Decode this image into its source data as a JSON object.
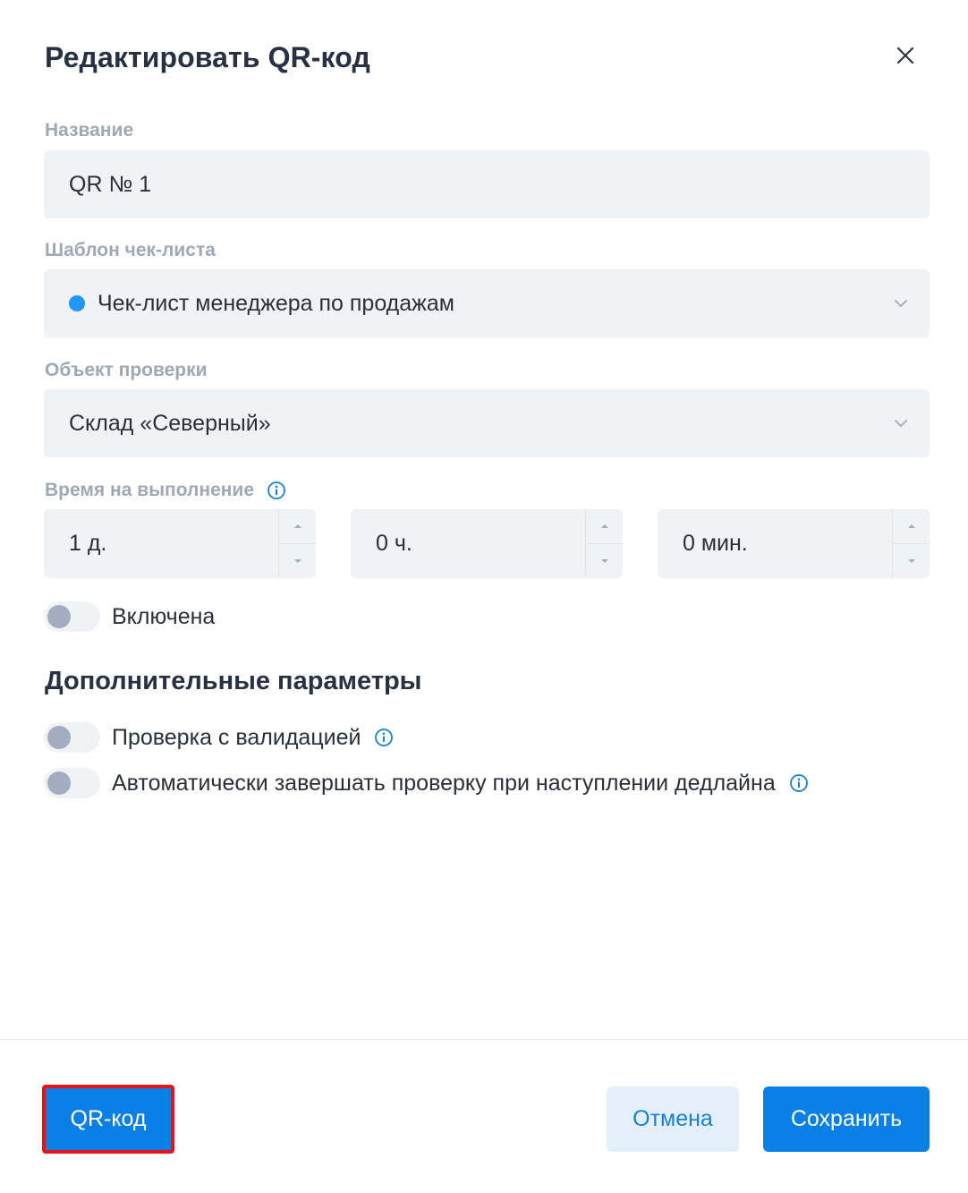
{
  "dialog": {
    "title": "Редактировать QR-код"
  },
  "form": {
    "name": {
      "label": "Название",
      "value": "QR № 1"
    },
    "template": {
      "label": "Шаблон чек-листа",
      "value": "Чек-лист менеджера по продажам",
      "dot_color": "#2196f3"
    },
    "object": {
      "label": "Объект проверки",
      "value": "Склад «Северный»"
    },
    "duration": {
      "label": "Время на выполнение",
      "days": "1 д.",
      "hours": "0 ч.",
      "minutes": "0 мин."
    },
    "enabled": {
      "label": "Включена",
      "on": false
    }
  },
  "extra": {
    "title": "Дополнительные параметры",
    "validation": {
      "label": "Проверка с валидацией",
      "on": false
    },
    "auto_complete": {
      "label": "Автоматически завершать проверку при наступлении дедлайна",
      "on": false
    }
  },
  "footer": {
    "qr_label": "QR-код",
    "cancel_label": "Отмена",
    "save_label": "Сохранить"
  },
  "colors": {
    "accent": "#0a80e6",
    "highlight_border": "#e5141b",
    "field_bg": "#f1f2f5",
    "label": "#9fa8b5"
  },
  "icons": {
    "close": "close-icon",
    "chevron": "chevron-down-icon",
    "info": "info-icon",
    "spin_up": "caret-up-icon",
    "spin_down": "caret-down-icon"
  }
}
